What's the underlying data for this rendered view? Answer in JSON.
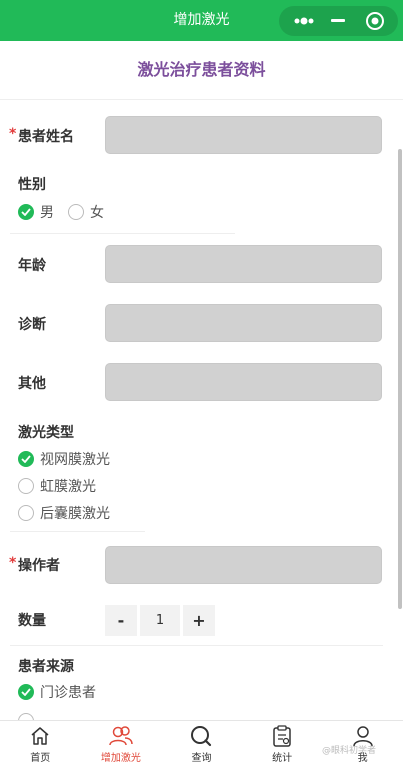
{
  "nav": {
    "title": "增加激光"
  },
  "page": {
    "title": "激光治疗患者资料"
  },
  "form": {
    "patient_name_label": "患者姓名",
    "gender_label": "性别",
    "gender_options": [
      {
        "label": "男",
        "checked": true
      },
      {
        "label": "女",
        "checked": false
      }
    ],
    "age_label": "年龄",
    "diagnosis_label": "诊断",
    "other_label": "其他",
    "laser_type_label": "激光类型",
    "laser_options": [
      {
        "label": "视网膜激光",
        "checked": true
      },
      {
        "label": "虹膜激光",
        "checked": false
      },
      {
        "label": "后囊膜激光",
        "checked": false
      }
    ],
    "operator_label": "操作者",
    "quantity_label": "数量",
    "quantity": {
      "minus": "-",
      "value": "1",
      "plus": "+"
    },
    "source_label": "患者来源",
    "source_options": [
      {
        "label": "门诊患者",
        "checked": true
      }
    ]
  },
  "tabbar": {
    "items": [
      {
        "label": "首页",
        "icon": "home-icon"
      },
      {
        "label": "增加激光",
        "icon": "users-icon",
        "active": true
      },
      {
        "label": "查询",
        "icon": "search-icon"
      },
      {
        "label": "统计",
        "icon": "clipboard-icon"
      },
      {
        "label": "我",
        "icon": "user-icon"
      }
    ]
  },
  "watermark": "@眼科初学者",
  "colors": {
    "brand": "#21ba58",
    "title": "#7c4f9c",
    "active_tab": "#e0493a",
    "required": "#e23b3b"
  }
}
